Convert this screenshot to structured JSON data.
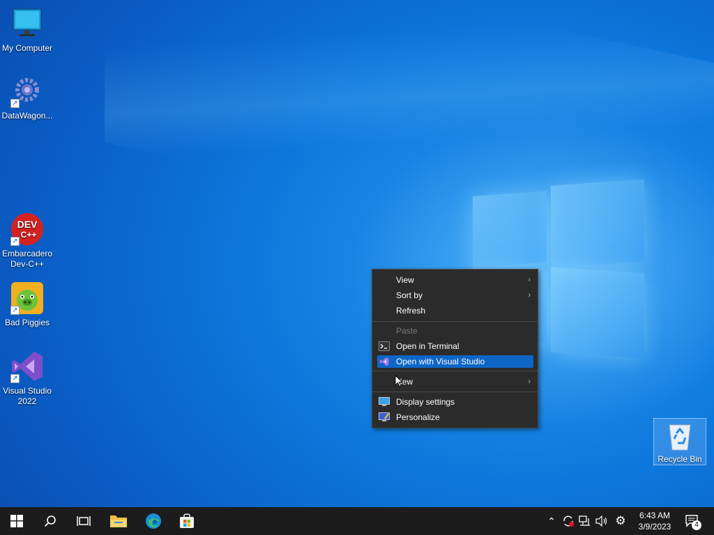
{
  "desktop": {
    "icons": [
      {
        "label": "My Computer"
      },
      {
        "label": "DataWagon..."
      },
      {
        "label": "Embarcadero Dev-C++",
        "badge": "DEV C++"
      },
      {
        "label": "Bad Piggies"
      },
      {
        "label": "Visual Studio 2022"
      }
    ],
    "recycle_bin": {
      "label": "Recycle Bin"
    }
  },
  "context_menu": {
    "items": [
      {
        "label": "View",
        "has_submenu": true
      },
      {
        "label": "Sort by",
        "has_submenu": true
      },
      {
        "label": "Refresh"
      },
      {
        "label": "Paste",
        "disabled": true
      },
      {
        "label": "Open in Terminal",
        "icon": "terminal-icon"
      },
      {
        "label": "Open with Visual Studio",
        "icon": "visual-studio-icon",
        "selected": true
      },
      {
        "label": "New",
        "has_submenu": true
      },
      {
        "label": "Display settings",
        "icon": "display-icon"
      },
      {
        "label": "Personalize",
        "icon": "personalize-icon"
      }
    ],
    "selection_color": "#0d66c6"
  },
  "taskbar": {
    "pinned": [
      "start-icon",
      "search-icon",
      "task-view-icon",
      "file-explorer-icon",
      "edge-icon",
      "store-icon"
    ],
    "tray": {
      "time": "6:43 AM",
      "date": "3/9/2023",
      "notification_count": "4"
    }
  }
}
